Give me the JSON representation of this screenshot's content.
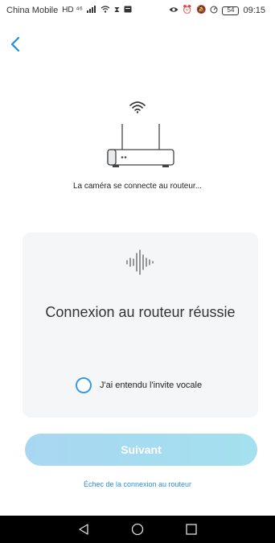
{
  "status_bar": {
    "carrier": "China Mobile",
    "network_badges": "HD ⁴⁶",
    "battery": "54",
    "time": "09:15"
  },
  "router": {
    "caption": "La caméra se connecte au routeur..."
  },
  "card": {
    "title": "Connexion au routeur réussie",
    "checkbox_label": "J'ai entendu l'invite vocale",
    "checkbox_checked": false
  },
  "next_button": {
    "label": "Suivant"
  },
  "fail_link": {
    "label": "Échec de la connexion au routeur"
  },
  "colors": {
    "accent": "#2c8fd6",
    "button_gradient_start": "#a8d7f2",
    "button_gradient_end": "#a4e0ee",
    "card_bg": "#f5f6f8"
  },
  "icons": {
    "back": "chevron-left-icon",
    "wifi": "wifi-icon",
    "router": "router-icon",
    "voice": "sound-wave-icon",
    "nav_back": "triangle-back-icon",
    "nav_home": "circle-home-icon",
    "nav_recent": "square-recent-icon"
  }
}
